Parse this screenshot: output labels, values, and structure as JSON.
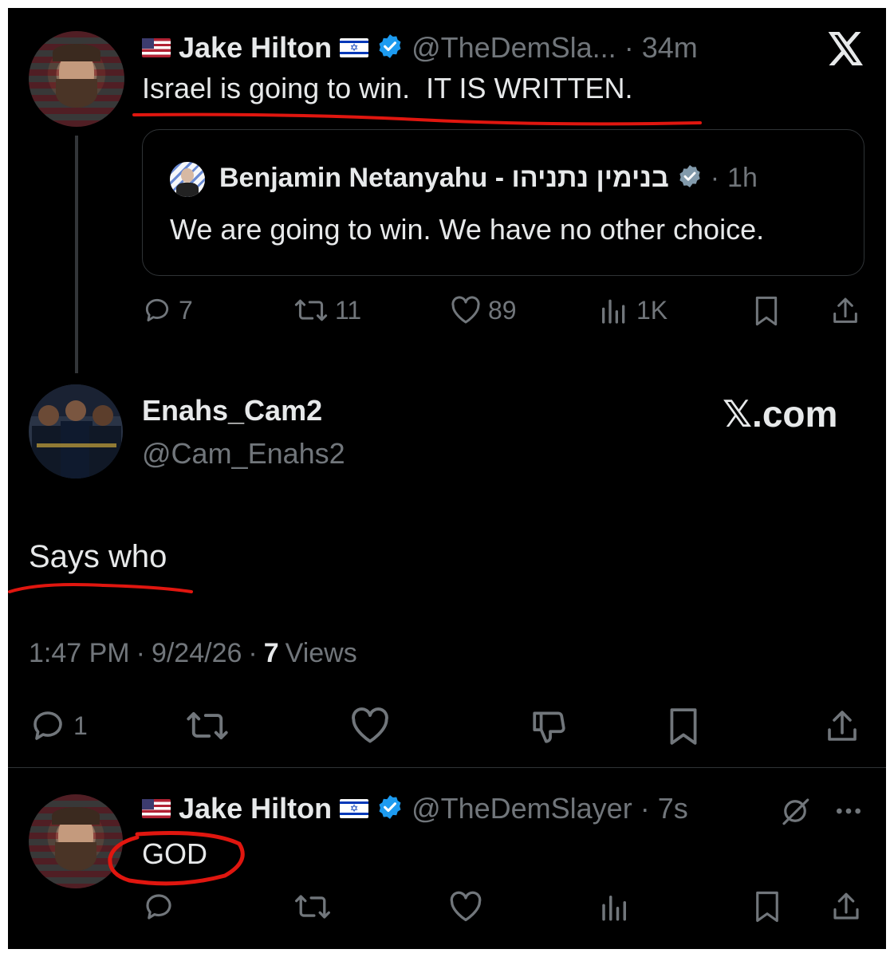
{
  "tweet1": {
    "name": "Jake Hilton",
    "handle": "@TheDemSla...",
    "time": "34m",
    "text": "Israel is going to win.  IT IS WRITTEN.",
    "quote": {
      "name": "Benjamin Netanyahu - בנימין נתניהו",
      "time": "1h",
      "text": "We are going to win. We have no other choice."
    },
    "replies": "7",
    "reposts": "11",
    "likes": "89",
    "views": "1K"
  },
  "main_tweet": {
    "name": "Enahs_Cam2",
    "handle": "@Cam_Enahs2",
    "brand": "𝕏.com",
    "text": "Says who",
    "time": "1:47 PM",
    "date": "9/24/26",
    "views_count": "7",
    "views_label": "Views",
    "replies": "1"
  },
  "reply": {
    "name": "Jake Hilton",
    "handle": "@TheDemSlayer",
    "time": "7s",
    "text": "GOD"
  },
  "separator": "·",
  "colors": {
    "bg": "#000000",
    "text": "#e7e9ea",
    "muted": "#71767b",
    "verified": "#1d9bf0",
    "annotation": "#e0160f"
  },
  "icons": [
    "x-logo-icon",
    "verified-badge-icon",
    "reply-icon",
    "repost-icon",
    "like-icon",
    "views-icon",
    "bookmark-icon",
    "share-icon",
    "dislike-icon",
    "grok-icon",
    "more-icon"
  ]
}
